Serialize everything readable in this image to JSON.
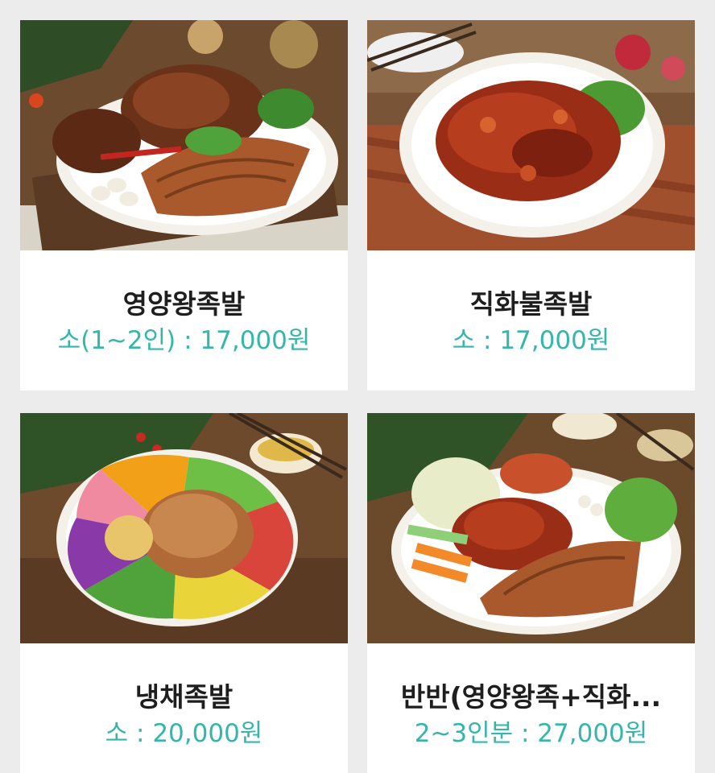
{
  "menu": {
    "items": [
      {
        "name": "영양왕족발",
        "price": "소(1~2인) : 17,000원",
        "image": "jokbal-plate-photo"
      },
      {
        "name": "직화불족발",
        "price": "소 : 17,000원",
        "image": "spicy-jokbal-plate-photo"
      },
      {
        "name": "냉채족발",
        "price": "소 : 20,000원",
        "image": "cold-jokbal-salad-photo"
      },
      {
        "name": "반반(영양왕족+직화...",
        "price": "2~3인분 : 27,000원",
        "image": "half-half-jokbal-photo"
      }
    ]
  },
  "colors": {
    "background": "#ececec",
    "card": "#ffffff",
    "name_text": "#1e1e1e",
    "price_text": "#36b5aa"
  }
}
